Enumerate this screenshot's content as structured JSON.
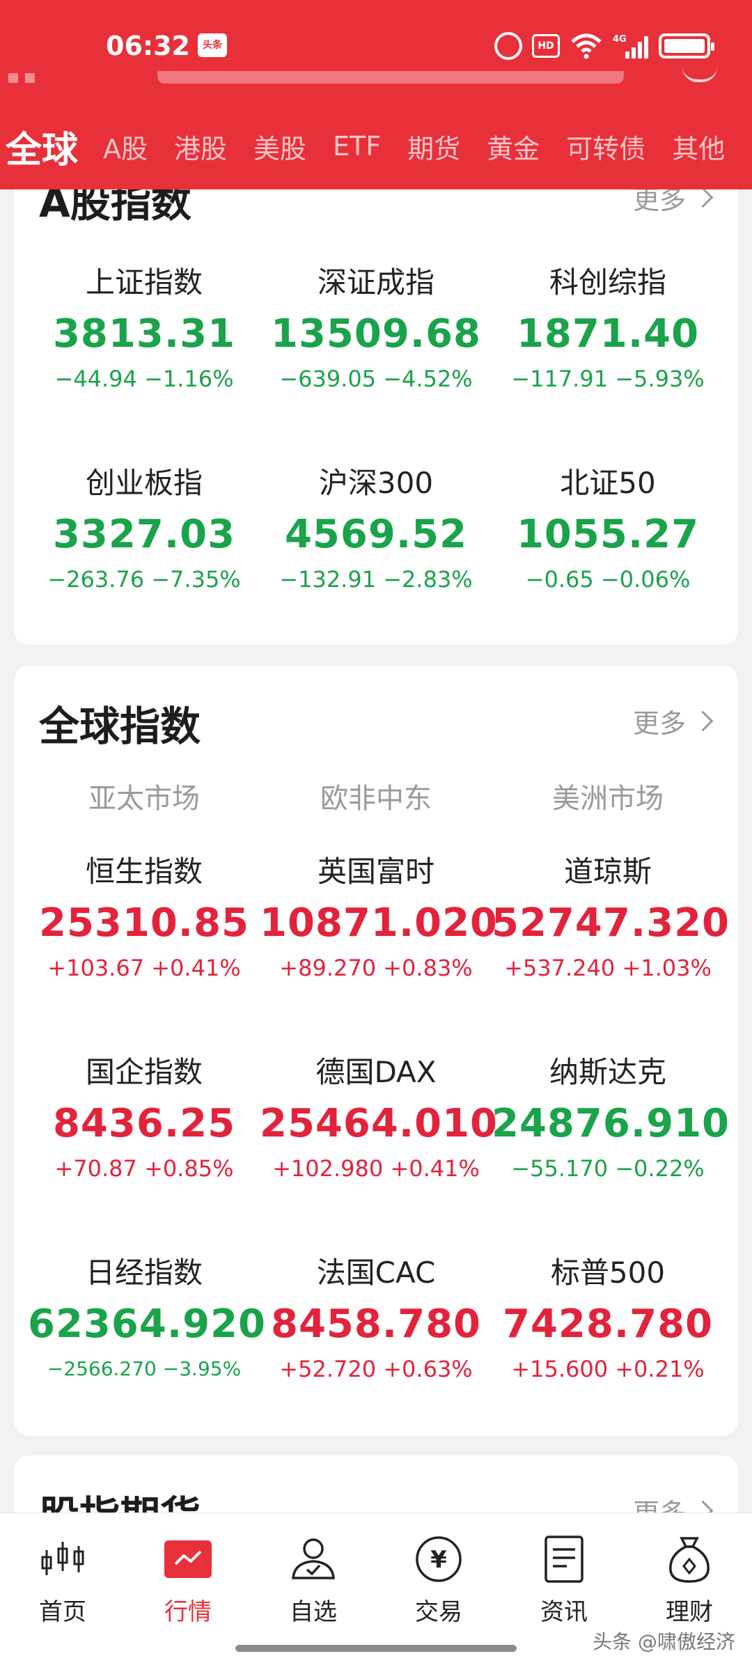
{
  "status_bar": {
    "time": "06:32",
    "app_badge": "头条",
    "hd_label": "HD",
    "network_label": "4G"
  },
  "tabs": [
    {
      "label": "全球"
    },
    {
      "label": "A股"
    },
    {
      "label": "港股"
    },
    {
      "label": "美股"
    },
    {
      "label": "ETF"
    },
    {
      "label": "期货"
    },
    {
      "label": "黄金"
    },
    {
      "label": "可转债"
    },
    {
      "label": "其他"
    }
  ],
  "a_share": {
    "title": "A股指数",
    "more": "更多",
    "items": [
      {
        "name": "上证指数",
        "value": "3813.31",
        "change": "−44.94  −1.16%",
        "color": "#1aa34a"
      },
      {
        "name": "深证成指",
        "value": "13509.68",
        "change": "−639.05  −4.52%",
        "color": "#1aa34a"
      },
      {
        "name": "科创综指",
        "value": "1871.40",
        "change": "−117.91  −5.93%",
        "color": "#1aa34a"
      },
      {
        "name": "创业板指",
        "value": "3327.03",
        "change": "−263.76  −7.35%",
        "color": "#1aa34a"
      },
      {
        "name": "沪深300",
        "value": "4569.52",
        "change": "−132.91  −2.83%",
        "color": "#1aa34a"
      },
      {
        "name": "北证50",
        "value": "1055.27",
        "change": "−0.65  −0.06%",
        "color": "#1aa34a"
      }
    ]
  },
  "global": {
    "title": "全球指数",
    "more": "更多",
    "regions": [
      "亚太市场",
      "欧非中东",
      "美洲市场"
    ],
    "items": [
      {
        "name": "恒生指数",
        "value": "25310.85",
        "change": "+103.67  +0.41%",
        "color": "#e2233b"
      },
      {
        "name": "英国富时",
        "value": "10871.020",
        "change": "+89.270  +0.83%",
        "color": "#e2233b"
      },
      {
        "name": "道琼斯",
        "value": "52747.320",
        "change": "+537.240  +1.03%",
        "color": "#e2233b"
      },
      {
        "name": "国企指数",
        "value": "8436.25",
        "change": "+70.87  +0.85%",
        "color": "#e2233b"
      },
      {
        "name": "德国DAX",
        "value": "25464.010",
        "change": "+102.980  +0.41%",
        "color": "#e2233b"
      },
      {
        "name": "纳斯达克",
        "value": "24876.910",
        "change": "−55.170  −0.22%",
        "color": "#1aa34a"
      },
      {
        "name": "日经指数",
        "value": "62364.920",
        "change": "−2566.270  −3.95%",
        "color": "#1aa34a"
      },
      {
        "name": "法国CAC",
        "value": "8458.780",
        "change": "+52.720  +0.63%",
        "color": "#e2233b"
      },
      {
        "name": "标普500",
        "value": "7428.780",
        "change": "+15.600  +0.21%",
        "color": "#e2233b"
      }
    ]
  },
  "futures": {
    "title": "股指期货",
    "more": "更多"
  },
  "bottom_nav": [
    {
      "label": "首页",
      "icon": "candlestick-icon"
    },
    {
      "label": "行情",
      "icon": "market-chart-icon"
    },
    {
      "label": "自选",
      "icon": "user-watchlist-icon"
    },
    {
      "label": "交易",
      "icon": "yuan-coin-icon"
    },
    {
      "label": "资讯",
      "icon": "news-document-icon"
    },
    {
      "label": "理财",
      "icon": "money-bag-icon"
    }
  ],
  "watermark": "头条 @啸傲经济"
}
